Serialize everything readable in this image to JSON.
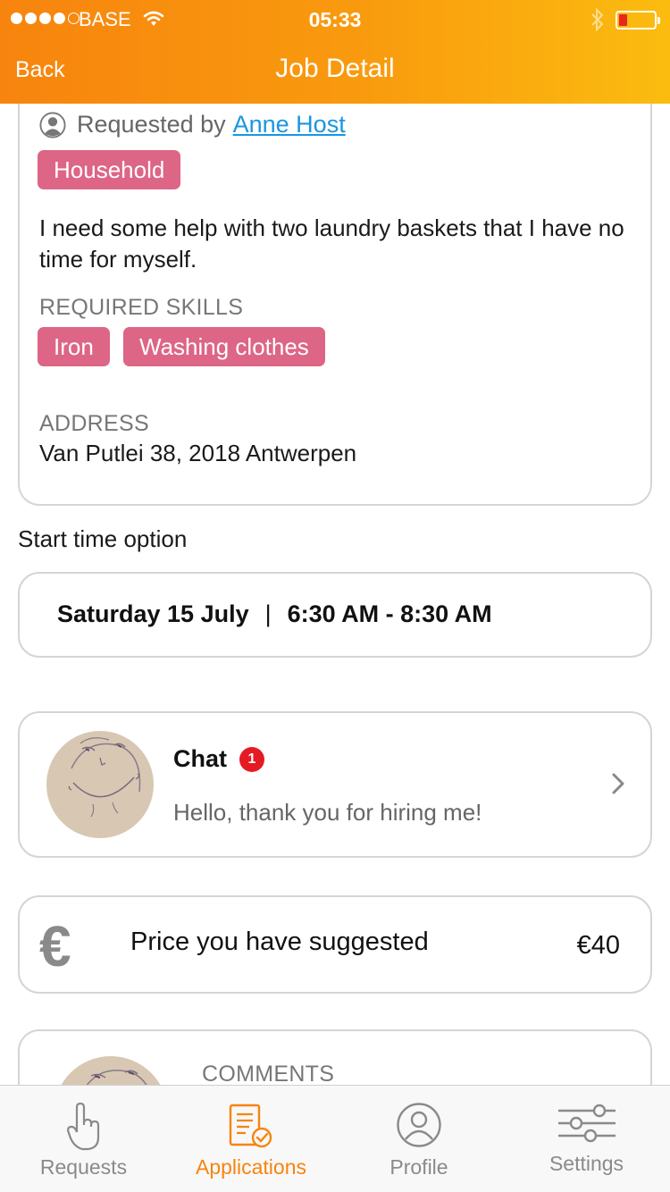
{
  "status_bar": {
    "carrier": "BASE",
    "time": "05:33",
    "battery_level": 0.15,
    "battery_color": "#e8261c"
  },
  "header": {
    "back_label": "Back",
    "title": "Job Detail",
    "gradient": [
      "#f7840e",
      "#fbbc0f"
    ]
  },
  "job": {
    "requested_by_label": "Requested by",
    "requester": "Anne Host",
    "category": "Household",
    "description": "I need some help with two laundry baskets that I have no time for myself.",
    "skills_label": "REQUIRED SKILLS",
    "skills": [
      "Iron",
      "Washing clothes"
    ],
    "address_label": "ADDRESS",
    "address": "Van Putlei 38, 2018 Antwerpen",
    "tag_color": "#dd6585"
  },
  "start_time": {
    "label": "Start time option",
    "date": "Saturday 15 July",
    "separator": "|",
    "range": "6:30 AM - 8:30 AM"
  },
  "chat": {
    "title": "Chat",
    "unread_count": "1",
    "last_message": "Hello, thank you for hiring me!",
    "badge_color": "#e51b23"
  },
  "price": {
    "icon": "euro-icon",
    "label": "Price you have suggested",
    "value": "€40"
  },
  "comments": {
    "label": "COMMENTS"
  },
  "tabbar": {
    "items": [
      {
        "label": "Requests",
        "icon": "hand-pointer-icon",
        "active": false
      },
      {
        "label": "Applications",
        "icon": "document-check-icon",
        "active": true
      },
      {
        "label": "Profile",
        "icon": "person-circle-icon",
        "active": false
      },
      {
        "label": "Settings",
        "icon": "sliders-icon",
        "active": false
      }
    ],
    "active_color": "#f7840e"
  }
}
